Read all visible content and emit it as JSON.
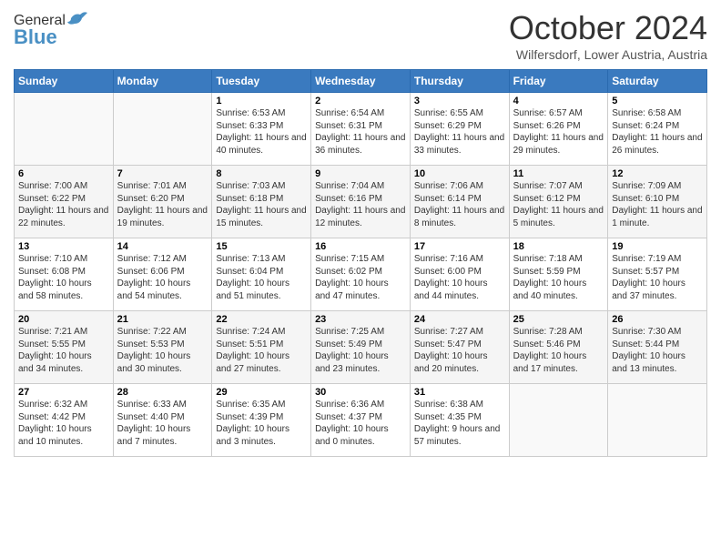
{
  "header": {
    "logo": {
      "general": "General",
      "blue": "Blue"
    },
    "title": "October 2024",
    "subtitle": "Wilfersdorf, Lower Austria, Austria"
  },
  "calendar": {
    "days_of_week": [
      "Sunday",
      "Monday",
      "Tuesday",
      "Wednesday",
      "Thursday",
      "Friday",
      "Saturday"
    ],
    "weeks": [
      [
        {
          "day": "",
          "sunrise": "",
          "sunset": "",
          "daylight": ""
        },
        {
          "day": "",
          "sunrise": "",
          "sunset": "",
          "daylight": ""
        },
        {
          "day": "1",
          "sunrise": "Sunrise: 6:53 AM",
          "sunset": "Sunset: 6:33 PM",
          "daylight": "Daylight: 11 hours and 40 minutes."
        },
        {
          "day": "2",
          "sunrise": "Sunrise: 6:54 AM",
          "sunset": "Sunset: 6:31 PM",
          "daylight": "Daylight: 11 hours and 36 minutes."
        },
        {
          "day": "3",
          "sunrise": "Sunrise: 6:55 AM",
          "sunset": "Sunset: 6:29 PM",
          "daylight": "Daylight: 11 hours and 33 minutes."
        },
        {
          "day": "4",
          "sunrise": "Sunrise: 6:57 AM",
          "sunset": "Sunset: 6:26 PM",
          "daylight": "Daylight: 11 hours and 29 minutes."
        },
        {
          "day": "5",
          "sunrise": "Sunrise: 6:58 AM",
          "sunset": "Sunset: 6:24 PM",
          "daylight": "Daylight: 11 hours and 26 minutes."
        }
      ],
      [
        {
          "day": "6",
          "sunrise": "Sunrise: 7:00 AM",
          "sunset": "Sunset: 6:22 PM",
          "daylight": "Daylight: 11 hours and 22 minutes."
        },
        {
          "day": "7",
          "sunrise": "Sunrise: 7:01 AM",
          "sunset": "Sunset: 6:20 PM",
          "daylight": "Daylight: 11 hours and 19 minutes."
        },
        {
          "day": "8",
          "sunrise": "Sunrise: 7:03 AM",
          "sunset": "Sunset: 6:18 PM",
          "daylight": "Daylight: 11 hours and 15 minutes."
        },
        {
          "day": "9",
          "sunrise": "Sunrise: 7:04 AM",
          "sunset": "Sunset: 6:16 PM",
          "daylight": "Daylight: 11 hours and 12 minutes."
        },
        {
          "day": "10",
          "sunrise": "Sunrise: 7:06 AM",
          "sunset": "Sunset: 6:14 PM",
          "daylight": "Daylight: 11 hours and 8 minutes."
        },
        {
          "day": "11",
          "sunrise": "Sunrise: 7:07 AM",
          "sunset": "Sunset: 6:12 PM",
          "daylight": "Daylight: 11 hours and 5 minutes."
        },
        {
          "day": "12",
          "sunrise": "Sunrise: 7:09 AM",
          "sunset": "Sunset: 6:10 PM",
          "daylight": "Daylight: 11 hours and 1 minute."
        }
      ],
      [
        {
          "day": "13",
          "sunrise": "Sunrise: 7:10 AM",
          "sunset": "Sunset: 6:08 PM",
          "daylight": "Daylight: 10 hours and 58 minutes."
        },
        {
          "day": "14",
          "sunrise": "Sunrise: 7:12 AM",
          "sunset": "Sunset: 6:06 PM",
          "daylight": "Daylight: 10 hours and 54 minutes."
        },
        {
          "day": "15",
          "sunrise": "Sunrise: 7:13 AM",
          "sunset": "Sunset: 6:04 PM",
          "daylight": "Daylight: 10 hours and 51 minutes."
        },
        {
          "day": "16",
          "sunrise": "Sunrise: 7:15 AM",
          "sunset": "Sunset: 6:02 PM",
          "daylight": "Daylight: 10 hours and 47 minutes."
        },
        {
          "day": "17",
          "sunrise": "Sunrise: 7:16 AM",
          "sunset": "Sunset: 6:00 PM",
          "daylight": "Daylight: 10 hours and 44 minutes."
        },
        {
          "day": "18",
          "sunrise": "Sunrise: 7:18 AM",
          "sunset": "Sunset: 5:59 PM",
          "daylight": "Daylight: 10 hours and 40 minutes."
        },
        {
          "day": "19",
          "sunrise": "Sunrise: 7:19 AM",
          "sunset": "Sunset: 5:57 PM",
          "daylight": "Daylight: 10 hours and 37 minutes."
        }
      ],
      [
        {
          "day": "20",
          "sunrise": "Sunrise: 7:21 AM",
          "sunset": "Sunset: 5:55 PM",
          "daylight": "Daylight: 10 hours and 34 minutes."
        },
        {
          "day": "21",
          "sunrise": "Sunrise: 7:22 AM",
          "sunset": "Sunset: 5:53 PM",
          "daylight": "Daylight: 10 hours and 30 minutes."
        },
        {
          "day": "22",
          "sunrise": "Sunrise: 7:24 AM",
          "sunset": "Sunset: 5:51 PM",
          "daylight": "Daylight: 10 hours and 27 minutes."
        },
        {
          "day": "23",
          "sunrise": "Sunrise: 7:25 AM",
          "sunset": "Sunset: 5:49 PM",
          "daylight": "Daylight: 10 hours and 23 minutes."
        },
        {
          "day": "24",
          "sunrise": "Sunrise: 7:27 AM",
          "sunset": "Sunset: 5:47 PM",
          "daylight": "Daylight: 10 hours and 20 minutes."
        },
        {
          "day": "25",
          "sunrise": "Sunrise: 7:28 AM",
          "sunset": "Sunset: 5:46 PM",
          "daylight": "Daylight: 10 hours and 17 minutes."
        },
        {
          "day": "26",
          "sunrise": "Sunrise: 7:30 AM",
          "sunset": "Sunset: 5:44 PM",
          "daylight": "Daylight: 10 hours and 13 minutes."
        }
      ],
      [
        {
          "day": "27",
          "sunrise": "Sunrise: 6:32 AM",
          "sunset": "Sunset: 4:42 PM",
          "daylight": "Daylight: 10 hours and 10 minutes."
        },
        {
          "day": "28",
          "sunrise": "Sunrise: 6:33 AM",
          "sunset": "Sunset: 4:40 PM",
          "daylight": "Daylight: 10 hours and 7 minutes."
        },
        {
          "day": "29",
          "sunrise": "Sunrise: 6:35 AM",
          "sunset": "Sunset: 4:39 PM",
          "daylight": "Daylight: 10 hours and 3 minutes."
        },
        {
          "day": "30",
          "sunrise": "Sunrise: 6:36 AM",
          "sunset": "Sunset: 4:37 PM",
          "daylight": "Daylight: 10 hours and 0 minutes."
        },
        {
          "day": "31",
          "sunrise": "Sunrise: 6:38 AM",
          "sunset": "Sunset: 4:35 PM",
          "daylight": "Daylight: 9 hours and 57 minutes."
        },
        {
          "day": "",
          "sunrise": "",
          "sunset": "",
          "daylight": ""
        },
        {
          "day": "",
          "sunrise": "",
          "sunset": "",
          "daylight": ""
        }
      ]
    ]
  }
}
